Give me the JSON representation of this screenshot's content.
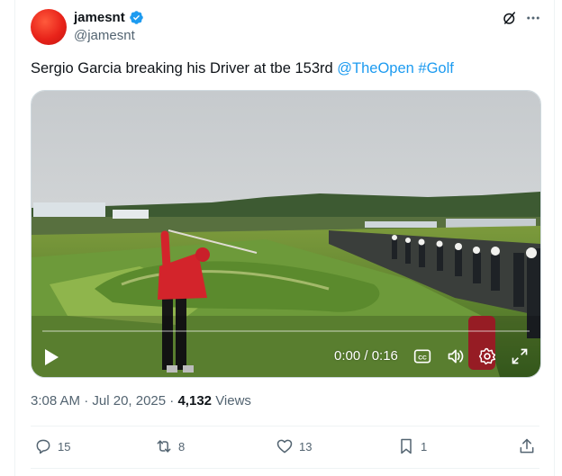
{
  "author": {
    "display_name": "jamesnt",
    "handle": "@jamesnt"
  },
  "tweet": {
    "text_plain": "Sergio Garcia breaking his Driver at tbe 153rd",
    "mention": "@TheOpen",
    "hashtag": "#Golf"
  },
  "video": {
    "time_display": "0:00 / 0:16",
    "progress": 0
  },
  "meta": {
    "time": "3:08 AM",
    "date": "Jul 20, 2025",
    "views_count": "4,132",
    "views_label": "Views"
  },
  "actions": {
    "replies": "15",
    "reposts": "8",
    "likes": "13",
    "bookmarks": "1"
  },
  "colors": {
    "link": "#1d9bf0",
    "verified": "#1d9bf0",
    "secondary_text": "#536471"
  },
  "icons": [
    "verified-badge-icon",
    "grok-icon",
    "more-icon",
    "play-icon",
    "captions-icon",
    "volume-icon",
    "settings-icon",
    "fullscreen-icon",
    "reply-icon",
    "repost-icon",
    "like-icon",
    "bookmark-icon",
    "share-icon"
  ]
}
